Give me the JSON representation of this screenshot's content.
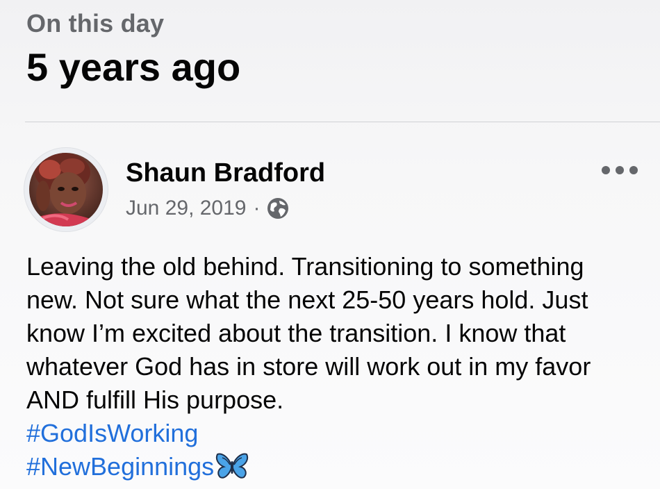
{
  "memory": {
    "subtitle": "On this day",
    "title": "5 years ago"
  },
  "post": {
    "author": "Shaun Bradford",
    "date": "Jun 29, 2019",
    "separator": "·",
    "privacy_icon": "globe-icon",
    "menu_icon": "more-horizontal-icon",
    "text": "Leaving the old behind. Transitioning to something new. Not sure what the next 25-50 years hold. Just know I’m excited about the transition. I know that whatever God has in store will work out in my favor AND fulfill His purpose.",
    "hashtags": [
      "#GodIsWorking",
      "#NewBeginnings"
    ],
    "emoji_icon": "butterfly-icon"
  },
  "colors": {
    "link": "#216fdb",
    "secondary_text": "#65676b",
    "primary_text": "#050505",
    "butterfly": "#4aa3e8"
  }
}
